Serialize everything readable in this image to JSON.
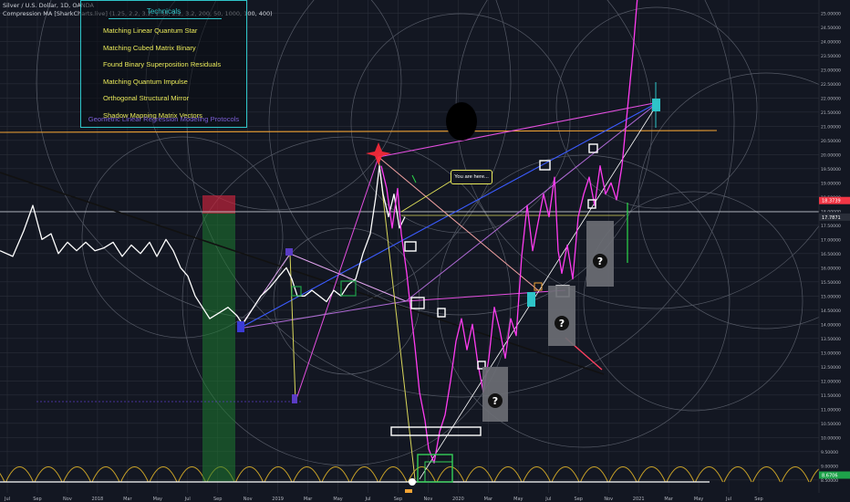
{
  "header": {
    "symbol_line": "Silver / U.S. Dollar, 1D, OANDA",
    "indicator_line": "Compression MA [SharkCharts.live] (1.25, 2.2, 3.2, 1.35, 2.2, 3.2, 200, 50, 1000, 100, 400)"
  },
  "panel": {
    "title": "Technicals",
    "items": [
      "Matching Linear Quantum Star",
      "Matching Cubed Matrix Binary",
      "Found Binary Superposition Residuals",
      "Matching Quantum Impulse",
      "Orthogonal Structural Mirror",
      "Shadow Mapping Matrix Vectors"
    ],
    "footer": "Geometric Linear Regression Modeling Protocols"
  },
  "callout": {
    "text": "You are here..."
  },
  "mystery_symbol": "?",
  "chart_data": {
    "type": "line",
    "symbol": "Silver / U.S. Dollar, 1D, OANDA",
    "y_ticks": [
      "25.00000",
      "24.50000",
      "24.00000",
      "23.50000",
      "23.00000",
      "22.50000",
      "22.00000",
      "21.50000",
      "21.00000",
      "20.50000",
      "20.00000",
      "19.50000",
      "19.00000",
      "18.50000",
      "18.00000",
      "17.50000",
      "17.00000",
      "16.50000",
      "16.00000",
      "15.50000",
      "15.00000",
      "14.50000",
      "14.00000",
      "13.50000",
      "13.00000",
      "12.50000",
      "12.00000",
      "11.50000",
      "11.00000",
      "10.50000",
      "10.00000",
      "9.50000",
      "9.00000",
      "8.50000"
    ],
    "x_ticks": [
      "Jul",
      "Sep",
      "Nov",
      "2018",
      "Mar",
      "May",
      "Jul",
      "Sep",
      "Nov",
      "2019",
      "Mar",
      "May",
      "Jul",
      "Sep",
      "Nov",
      "2020",
      "Mar",
      "May",
      "Jul",
      "Sep",
      "Nov",
      "2021",
      "Mar",
      "May",
      "Jul",
      "Sep"
    ],
    "ylim": [
      8.3,
      25.3
    ],
    "price_labels": [
      {
        "value": "18.3739",
        "color": "#f23645"
      },
      {
        "value": "17.8349",
        "color": "#131722"
      },
      {
        "value": "17.7871",
        "color": "#2a2e39"
      },
      {
        "value": "8.6706",
        "color": "#1ea34a"
      }
    ],
    "series": [
      {
        "color": "#ffffff",
        "points": [
          [
            0,
            16.6
          ],
          [
            14,
            16.4
          ],
          [
            26,
            17.3
          ],
          [
            36,
            18.2
          ],
          [
            46,
            17.0
          ],
          [
            56,
            17.2
          ],
          [
            64,
            16.5
          ],
          [
            74,
            16.9
          ],
          [
            84,
            16.6
          ],
          [
            94,
            16.9
          ],
          [
            104,
            16.6
          ],
          [
            114,
            16.7
          ],
          [
            124,
            16.9
          ],
          [
            134,
            16.4
          ],
          [
            144,
            16.8
          ],
          [
            154,
            16.5
          ],
          [
            164,
            16.9
          ],
          [
            172,
            16.4
          ],
          [
            182,
            17.0
          ],
          [
            190,
            16.6
          ],
          [
            198,
            16.0
          ],
          [
            206,
            15.7
          ],
          [
            214,
            15.0
          ],
          [
            222,
            14.6
          ],
          [
            230,
            14.2
          ],
          [
            240,
            14.4
          ],
          [
            250,
            14.6
          ],
          [
            260,
            14.3
          ],
          [
            266,
            14.0
          ],
          [
            276,
            14.5
          ],
          [
            286,
            15.0
          ],
          [
            296,
            15.3
          ],
          [
            306,
            15.7
          ],
          [
            314,
            16.0
          ],
          [
            320,
            15.6
          ],
          [
            326,
            15.0
          ],
          [
            334,
            15.0
          ],
          [
            342,
            15.2
          ],
          [
            350,
            15.0
          ],
          [
            358,
            14.8
          ],
          [
            366,
            15.2
          ],
          [
            374,
            15.0
          ],
          [
            382,
            15.4
          ],
          [
            390,
            15.6
          ],
          [
            398,
            16.5
          ],
          [
            406,
            17.2
          ],
          [
            412,
            18.5
          ],
          [
            416,
            19.6
          ],
          [
            420,
            18.6
          ],
          [
            426,
            17.8
          ],
          [
            432,
            18.6
          ],
          [
            438,
            17.4
          ],
          [
            444,
            17.8
          ]
        ]
      },
      {
        "color": "#ff3cf0",
        "points": [
          [
            418,
            19.6
          ],
          [
            424,
            18.8
          ],
          [
            430,
            17.4
          ],
          [
            436,
            18.8
          ],
          [
            440,
            17.2
          ],
          [
            446,
            15.8
          ],
          [
            450,
            14.6
          ],
          [
            455,
            13.2
          ],
          [
            460,
            11.6
          ],
          [
            466,
            10.6
          ],
          [
            470,
            9.6
          ],
          [
            476,
            9.1
          ],
          [
            482,
            10.2
          ],
          [
            488,
            10.8
          ],
          [
            494,
            12.0
          ],
          [
            500,
            13.4
          ],
          [
            506,
            14.2
          ],
          [
            512,
            13.1
          ],
          [
            518,
            14.0
          ],
          [
            524,
            12.6
          ],
          [
            530,
            11.6
          ],
          [
            536,
            12.8
          ],
          [
            542,
            14.6
          ],
          [
            548,
            13.8
          ],
          [
            554,
            12.8
          ],
          [
            560,
            14.2
          ],
          [
            566,
            13.6
          ],
          [
            572,
            16.4
          ],
          [
            578,
            18.2
          ],
          [
            584,
            16.6
          ],
          [
            590,
            17.6
          ],
          [
            596,
            18.6
          ],
          [
            602,
            17.8
          ],
          [
            608,
            19.2
          ],
          [
            612,
            16.6
          ],
          [
            616,
            15.8
          ],
          [
            622,
            16.8
          ],
          [
            628,
            15.6
          ],
          [
            634,
            17.8
          ],
          [
            640,
            18.6
          ],
          [
            646,
            19.2
          ],
          [
            652,
            18.2
          ],
          [
            658,
            19.6
          ],
          [
            664,
            18.6
          ],
          [
            670,
            19.0
          ],
          [
            676,
            18.4
          ],
          [
            682,
            19.6
          ],
          [
            688,
            21.6
          ],
          [
            694,
            23.6
          ],
          [
            700,
            26.0
          ]
        ]
      }
    ]
  }
}
